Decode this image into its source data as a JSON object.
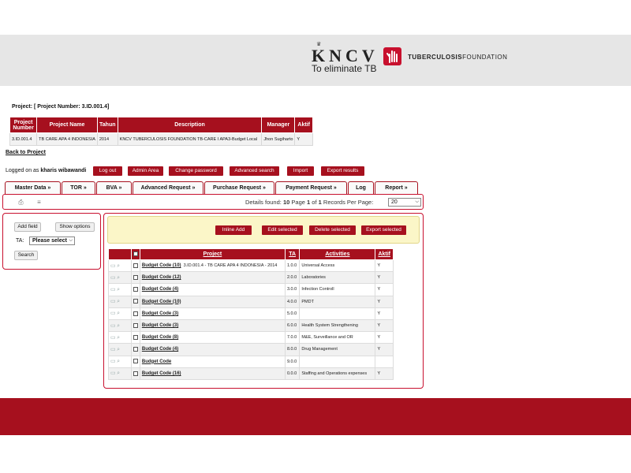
{
  "logo": {
    "brand": "KNCV",
    "crown": "♛",
    "slogan": "To eliminate TB",
    "foundation_bold": "TUBERCULOSIS",
    "foundation_rest": "FOUNDATION"
  },
  "project": {
    "title": "Project: [ Project Number: 3.ID.001.4]",
    "columns": [
      "Project Number",
      "Project Name",
      "Tahun",
      "Description",
      "Manager",
      "Aktif"
    ],
    "row": [
      "3.ID.001.4",
      "TB CARE APA 4 INDONESIA",
      "2014",
      "KNCV TUBERCULOSIS FOUNDATION TB-CARE I APA3-Budget Local",
      "Jhon Sugiharto",
      "Y"
    ],
    "back_link": "Back to Project"
  },
  "user_bar": {
    "logged_prefix": "Logged on as",
    "user": "kharis wibawandi",
    "buttons": [
      "Log out",
      "Admin Area",
      "Change password",
      "Advanced search",
      "Import",
      "Export results"
    ]
  },
  "tabs": [
    "Master Data »",
    "TOR »",
    "BVA »",
    "Advanced Request »",
    "Purchase Request »",
    "Payment Request »",
    "Log",
    "Report »"
  ],
  "toolbar": {
    "details_label": "Details found:",
    "found": "10",
    "page_label": "Page",
    "page": "1",
    "of_label": "of",
    "pages": "1",
    "records_label": "Records Per Page:",
    "per_page": "20"
  },
  "filter": {
    "add_field": "Add field",
    "show_options": "Show options",
    "ta_label": "TA:",
    "ta_value": "Please select",
    "search": "Search"
  },
  "actions": [
    "Inline Add",
    "Edit selected",
    "Delete selected",
    "Export selected"
  ],
  "grid": {
    "columns": [
      "Project",
      "TA",
      "Activities",
      "Aktif"
    ],
    "rows": [
      {
        "code": "Budget Code (10)",
        "project": "3.ID.001.4 - TB CARE APA 4 INDONESIA - 2014",
        "ta": "1.0.0",
        "activity": "Universal Access",
        "aktif": "Y"
      },
      {
        "code": "Budget Code (12)",
        "project": "",
        "ta": "2.0.0",
        "activity": "Laboratories",
        "aktif": "Y"
      },
      {
        "code": "Budget Code (4)",
        "project": "",
        "ta": "3.0.0",
        "activity": "Infection Controll",
        "aktif": "Y"
      },
      {
        "code": "Budget Code (10)",
        "project": "",
        "ta": "4.0.0",
        "activity": "PMDT",
        "aktif": "Y"
      },
      {
        "code": "Budget Code (3)",
        "project": "",
        "ta": "5.0.0",
        "activity": "",
        "aktif": "Y"
      },
      {
        "code": "Budget Code (3)",
        "project": "",
        "ta": "6.0.0",
        "activity": "Health System Strengthening",
        "aktif": "Y"
      },
      {
        "code": "Budget Code (8)",
        "project": "",
        "ta": "7.0.0",
        "activity": "M&E, Surveillance and OR",
        "aktif": "Y"
      },
      {
        "code": "Budget Code (4)",
        "project": "",
        "ta": "8.0.0",
        "activity": "Drug Management",
        "aktif": "Y"
      },
      {
        "code": "Budget Code",
        "project": "",
        "ta": "9.0.0",
        "activity": "",
        "aktif": ""
      },
      {
        "code": "Budget Code (16)",
        "project": "",
        "ta": "0.0.0",
        "activity": "Staffing and Operations expenses",
        "aktif": "Y"
      }
    ]
  },
  "colors": {
    "accent": "#a6101e",
    "header_bg": "#e6e6e6",
    "action_bar_bg": "#fbf6c8"
  },
  "icons": [
    "print-icon",
    "print-preview-icon",
    "view-icon",
    "edit-icon",
    "dropdown-caret-icon"
  ]
}
